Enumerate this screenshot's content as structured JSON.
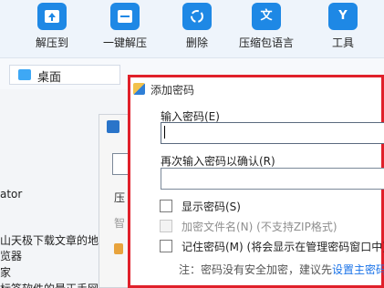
{
  "toolbar": {
    "items": [
      {
        "label": "解压到",
        "icon": "extract-to-icon"
      },
      {
        "label": "一键解压",
        "icon": "one-click-extract-icon"
      },
      {
        "label": "删除",
        "icon": "recycle-icon"
      },
      {
        "label": "压缩包语言",
        "icon": "language-icon",
        "glyph": "文"
      },
      {
        "label": "工具",
        "icon": "tools-icon",
        "glyph": "Y"
      }
    ]
  },
  "address": {
    "label": "桌面"
  },
  "tree": {
    "items": [
      "ator",
      "山天极下载文章的地址",
      "览器",
      "家",
      "标签软件的最正手网"
    ]
  },
  "background_dialog": {
    "chars": [
      "压",
      "智"
    ]
  },
  "dialog": {
    "title": "添加密码",
    "enter_password_label": "输入密码(E)",
    "confirm_password_label": "再次输入密码以确认(R)",
    "password_value": "",
    "confirm_value": "",
    "options": [
      {
        "label": "显示密码(S)",
        "checked": false,
        "enabled": true
      },
      {
        "label": "加密文件名(N) (不支持ZIP格式)",
        "checked": false,
        "enabled": false
      },
      {
        "label": "记住密码(M) (将会显示在管理密码窗口中)",
        "checked": false,
        "enabled": true
      }
    ],
    "note_prefix": "注：密码没有安全加密，建议先",
    "note_link": "设置主密码"
  },
  "colors": {
    "accent": "#1e88e5",
    "highlight_border": "#e0202a",
    "link": "#1a73e8"
  }
}
